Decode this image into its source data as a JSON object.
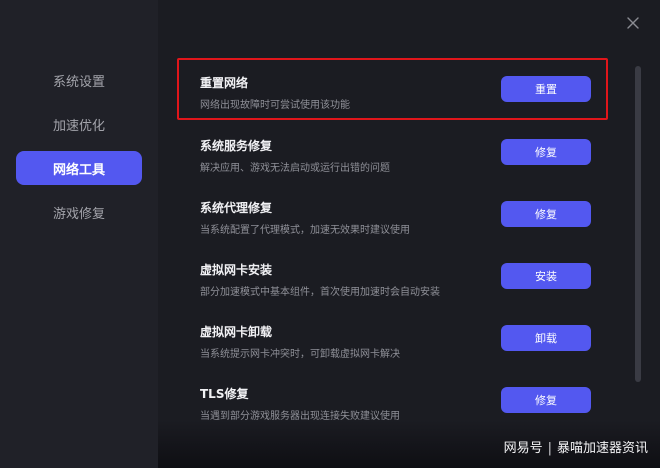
{
  "sidebar": {
    "items": [
      {
        "label": "系统设置",
        "active": false
      },
      {
        "label": "加速优化",
        "active": false
      },
      {
        "label": "网络工具",
        "active": true
      },
      {
        "label": "游戏修复",
        "active": false
      }
    ]
  },
  "close": {
    "icon": "close-icon"
  },
  "tools": [
    {
      "title": "重置网络",
      "desc": "网络出现故障时可尝试使用该功能",
      "button": "重置",
      "highlighted": true
    },
    {
      "title": "系统服务修复",
      "desc": "解决应用、游戏无法启动或运行出错的问题",
      "button": "修复"
    },
    {
      "title": "系统代理修复",
      "desc": "当系统配置了代理模式，加速无效果时建议使用",
      "button": "修复"
    },
    {
      "title": "虚拟网卡安装",
      "desc": "部分加速模式中基本组件，首次使用加速时会自动安装",
      "button": "安装"
    },
    {
      "title": "虚拟网卡卸载",
      "desc": "当系统提示网卡冲突时，可卸载虚拟网卡解决",
      "button": "卸载"
    },
    {
      "title": "TLS修复",
      "desc": "当遇到部分游戏服务器出现连接失败建议使用",
      "button": "修复"
    }
  ],
  "watermark": {
    "source": "网易号",
    "separator": "|",
    "author": "暴喵加速器资讯"
  },
  "colors": {
    "accent": "#5358f0",
    "highlight_border": "#e0161b",
    "background": "#1b1c22",
    "sidebar": "#202128"
  }
}
